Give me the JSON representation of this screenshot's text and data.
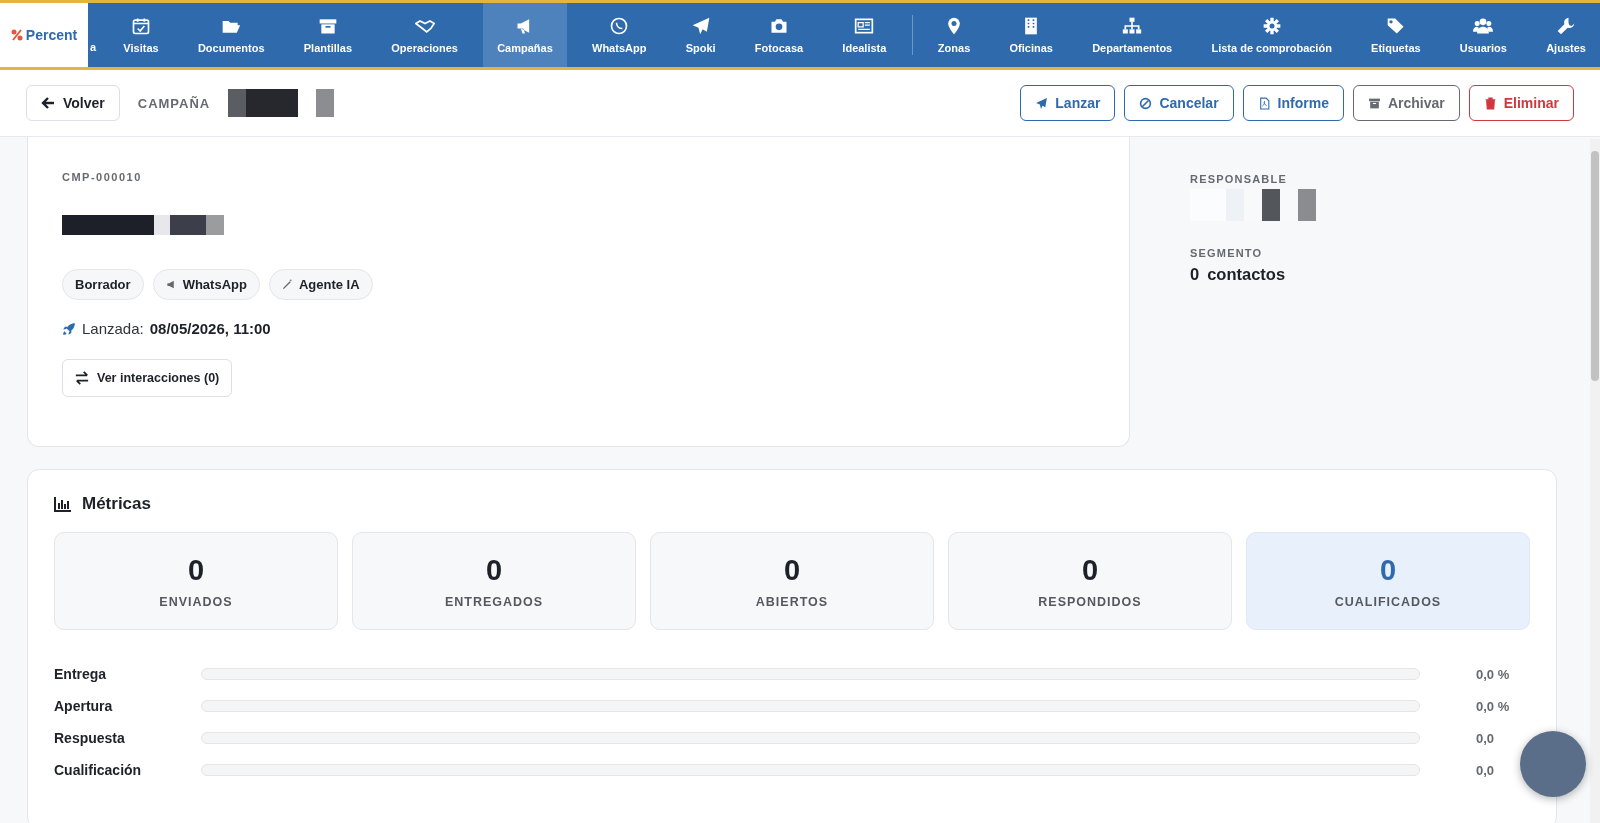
{
  "nav": {
    "logo": "Percent",
    "items": [
      {
        "label": "a",
        "selected": false
      },
      {
        "label": "Visitas",
        "selected": false
      },
      {
        "label": "Documentos",
        "selected": false
      },
      {
        "label": "Plantillas",
        "selected": false
      },
      {
        "label": "Operaciones",
        "selected": false
      },
      {
        "label": "Campañas",
        "selected": true
      },
      {
        "label": "WhatsApp",
        "selected": false
      },
      {
        "label": "Spoki",
        "selected": false
      },
      {
        "label": "Fotocasa",
        "selected": false
      },
      {
        "label": "Idealista",
        "selected": false
      },
      {
        "label": "Zonas",
        "selected": false
      },
      {
        "label": "Oficinas",
        "selected": false
      },
      {
        "label": "Departamentos",
        "selected": false
      },
      {
        "label": "Lista de comprobación",
        "selected": false
      },
      {
        "label": "Etiquetas",
        "selected": false
      },
      {
        "label": "Usuarios",
        "selected": false
      },
      {
        "label": "Ajustes",
        "selected": false
      }
    ]
  },
  "header": {
    "back": "Volver",
    "section": "CAMPAÑA",
    "actions": [
      {
        "label": "Lanzar",
        "color": "#2f6aad"
      },
      {
        "label": "Cancelar",
        "color": "#2f6aad"
      },
      {
        "label": "Informe",
        "color": "#2f6aad"
      },
      {
        "label": "Archivar",
        "color": "#666a70"
      },
      {
        "label": "Eliminar",
        "color": "#d0383e"
      }
    ]
  },
  "campaign": {
    "code": "CMP-000010",
    "tags": [
      "Borrador",
      "WhatsApp",
      "Agente IA"
    ],
    "launched_label": "Lanzada:",
    "launched_value": "08/05/2026, 11:00",
    "interactions_button": "Ver interacciones (0)"
  },
  "side": {
    "owner_label": "RESPONSABLE",
    "segment_label": "SEGMENTO",
    "segment_count": "0",
    "segment_unit": "contactos"
  },
  "metrics": {
    "title": "Métricas",
    "stats": [
      {
        "value": "0",
        "label": "ENVIADOS",
        "highlight": false
      },
      {
        "value": "0",
        "label": "ENTREGADOS",
        "highlight": false
      },
      {
        "value": "0",
        "label": "ABIERTOS",
        "highlight": false
      },
      {
        "value": "0",
        "label": "RESPONDIDOS",
        "highlight": false
      },
      {
        "value": "0",
        "label": "CUALIFICADOS",
        "highlight": true
      }
    ],
    "rates": [
      {
        "name": "Entrega",
        "level": 0,
        "reading": "0,0 %"
      },
      {
        "name": "Apertura",
        "level": 0,
        "reading": "0,0 %"
      },
      {
        "name": "Respuesta",
        "level": 0,
        "reading": "0,0"
      },
      {
        "name": "Cualificación",
        "level": 0,
        "reading": "0,0"
      }
    ]
  }
}
